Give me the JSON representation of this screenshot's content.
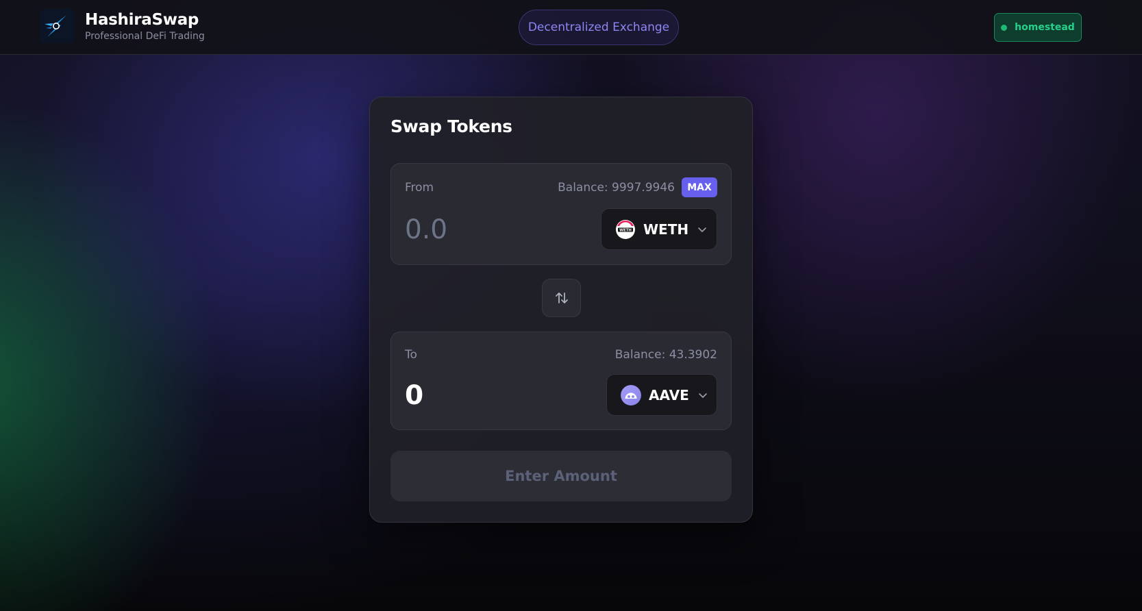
{
  "header": {
    "title": "HashiraSwap",
    "subtitle": "Professional DeFi Trading",
    "badge": "Decentralized Exchange",
    "network": "homestead",
    "network_color": "#27d08a"
  },
  "swap": {
    "title": "Swap Tokens",
    "from": {
      "label": "From",
      "balance": "Balance: 9997.9946",
      "max_label": "MAX",
      "amount_placeholder": "0.0",
      "token": "WETH",
      "token_icon": "weth-token-icon"
    },
    "switch_icon": "arrows-up-down-icon",
    "to": {
      "label": "To",
      "balance": "Balance: 43.3902",
      "amount": "0",
      "token": "AAVE",
      "token_icon": "aave-token-icon"
    },
    "submit_label": "Enter Amount"
  },
  "colors": {
    "accent": "#6760ee",
    "card": "#202028",
    "panel": "#2a2a32"
  }
}
